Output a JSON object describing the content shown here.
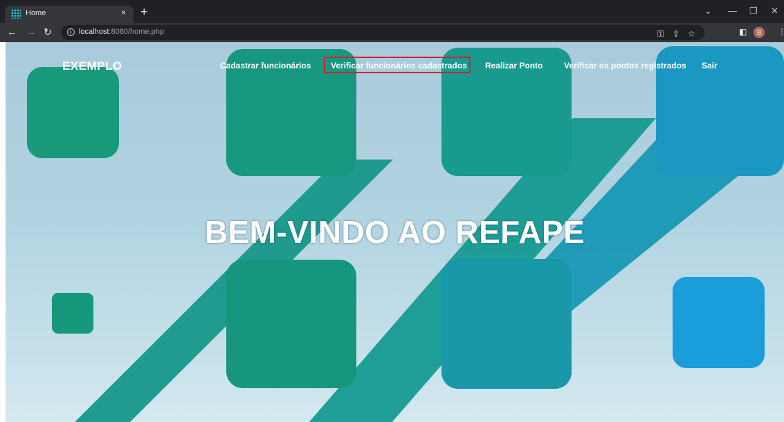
{
  "browser": {
    "tab_title": "Home",
    "tab_close": "×",
    "new_tab": "+",
    "url_host": "localhost",
    "url_rest": ":8080/home.php",
    "profile_initial": "B"
  },
  "site": {
    "brand": "EXEMPLO",
    "nav": [
      {
        "label": "Cadastrar funcionários"
      },
      {
        "label": "Verificar funcionários cadastrados"
      },
      {
        "label": "Realizar Ponto"
      },
      {
        "label": "Verificar os pontos registrados"
      },
      {
        "label": "Sair"
      }
    ],
    "hero_title": "BEM-VINDO AO REFAPE"
  },
  "colors": {
    "highlight_outline": "#d2232a",
    "shape_green": "#15977a",
    "shape_blue": "#1d9ad6"
  }
}
